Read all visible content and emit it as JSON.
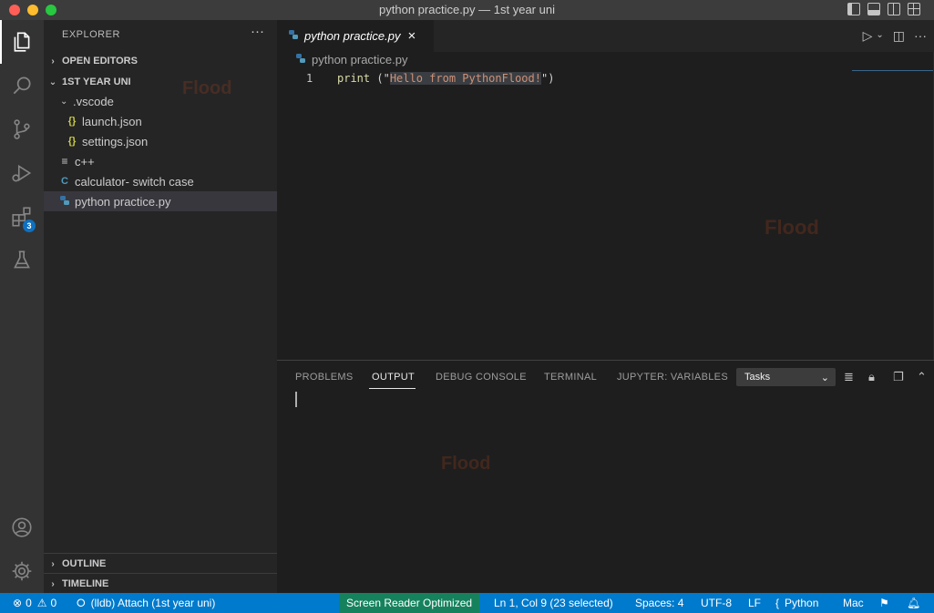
{
  "window": {
    "title": "python practice.py — 1st year uni"
  },
  "activity_bar": {
    "extensions_badge": "3"
  },
  "sidebar": {
    "title": "EXPLORER",
    "more": "···",
    "open_editors": "OPEN EDITORS",
    "workspace": "1ST YEAR UNI",
    "tree": [
      {
        "label": ".vscode",
        "icon": "chevron-down"
      },
      {
        "label": "launch.json",
        "icon": "json-icon"
      },
      {
        "label": "settings.json",
        "icon": "json-icon"
      },
      {
        "label": "c++",
        "icon": "text-file-icon"
      },
      {
        "label": "calculator- switch case",
        "icon": "c-file-icon"
      },
      {
        "label": "python practice.py",
        "icon": "python-icon"
      }
    ],
    "outline": "OUTLINE",
    "timeline": "TIMELINE"
  },
  "editor": {
    "tab_label": "python practice.py",
    "tab_close": "×",
    "breadcrumb": "python practice.py",
    "line_number": "1",
    "code": {
      "fn": "print",
      "open": " (\"",
      "selected": "Hello from PythonFlood!",
      "close": "\")"
    }
  },
  "panel": {
    "tabs": [
      "PROBLEMS",
      "OUTPUT",
      "DEBUG CONSOLE",
      "TERMINAL",
      "JUPYTER: VARIABLES"
    ],
    "active_tab": "OUTPUT",
    "select_value": "Tasks"
  },
  "statusbar": {
    "errors": "0",
    "warnings": "0",
    "debug": "(lldb) Attach (1st year uni)",
    "screen_reader": "Screen Reader Optimized",
    "position": "Ln 1, Col 9 (23 selected)",
    "spaces": "Spaces: 4",
    "encoding": "UTF-8",
    "eol": "LF",
    "language": "Python",
    "platform": "Mac"
  },
  "colors": {
    "accent": "#007acc",
    "screen_reader_bg": "#16825d",
    "traffic_red": "#ff5f57",
    "traffic_yellow": "#febc2e",
    "traffic_green": "#28c840"
  }
}
